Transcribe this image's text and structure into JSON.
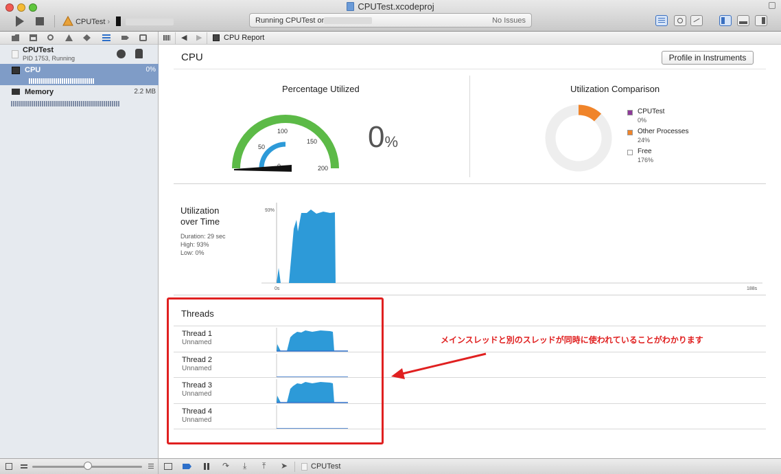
{
  "window": {
    "title": "CPUTest.xcodeproj"
  },
  "toolbar": {
    "scheme": "CPUTest",
    "status_text": "Running CPUTest on",
    "issues": "No Issues"
  },
  "navigator": {
    "process_name": "CPUTest",
    "process_status": "PID 1753, Running",
    "gauges": [
      {
        "label": "CPU",
        "value": "0%"
      },
      {
        "label": "Memory",
        "value": "2.2 MB"
      }
    ]
  },
  "jumpbar": {
    "item": "CPU Report"
  },
  "report": {
    "title": "CPU",
    "profile_button": "Profile in Instruments",
    "percentage": {
      "title": "Percentage Utilized",
      "value": "0",
      "unit": "%",
      "ticks": [
        "0",
        "50",
        "100",
        "150",
        "200"
      ]
    },
    "comparison": {
      "title": "Utilization Comparison",
      "legend": [
        {
          "name": "CPUTest",
          "value": "0%",
          "color": "#8e3a9a"
        },
        {
          "name": "Other Processes",
          "value": "24%",
          "color": "#f0842a"
        },
        {
          "name": "Free",
          "value": "176%",
          "color": "#ffffff"
        }
      ],
      "slices": [
        0,
        24,
        176
      ]
    },
    "over_time": {
      "title_line1": "Utilization",
      "title_line2": "over Time",
      "duration": "Duration: 29 sec",
      "high": "High: 93%",
      "low": "Low: 0%",
      "y_label": "93%",
      "x_start": "0s",
      "x_end": "188s"
    },
    "threads": {
      "title": "Threads",
      "items": [
        {
          "name": "Thread 1",
          "sub": "Unnamed",
          "active": true
        },
        {
          "name": "Thread 2",
          "sub": "Unnamed",
          "active": false
        },
        {
          "name": "Thread 3",
          "sub": "Unnamed",
          "active": true
        },
        {
          "name": "Thread 4",
          "sub": "Unnamed",
          "active": false
        }
      ]
    }
  },
  "annotation": {
    "text": "メインスレッドと別のスレッドが同時に使われていることがわかります",
    "color": "#e02020"
  },
  "debugbar": {
    "target": "CPUTest"
  },
  "colors": {
    "accent": "#2d9ad8",
    "gauge_outer": "#5cba47"
  }
}
